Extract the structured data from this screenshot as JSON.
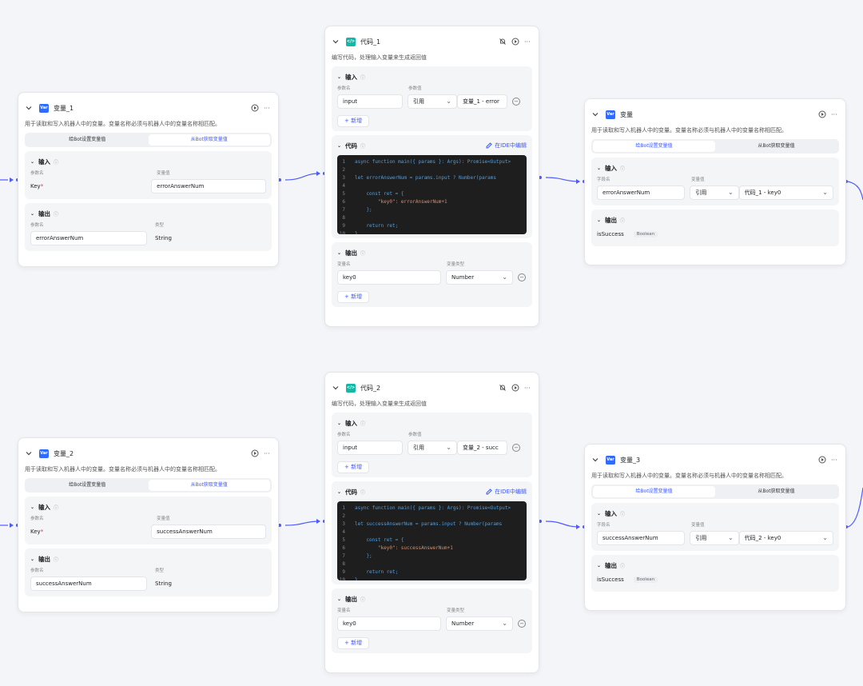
{
  "ui": {
    "expand": "⌄",
    "more": "···",
    "info": "ⓘ",
    "caret": "⌄",
    "minus": "−",
    "var_badge": "Var",
    "code_badge": "</>"
  },
  "nodes": {
    "var1": {
      "title": "变量_1",
      "desc": "用于读取和写入机器人中的变量。变量名称必须与机器人中的变量名称相匹配。",
      "seg": [
        "给Bot设置变量值",
        "从Bot获取变量值"
      ],
      "input_label": "输入",
      "col_param": "参数名",
      "col_value": "变量值",
      "key_label": "Key",
      "key_star": "*",
      "key_value": "errorAnswerNum",
      "output_label": "输出",
      "col_type": "类型",
      "out_name": "errorAnswerNum",
      "out_type": "String"
    },
    "code1": {
      "title": "代码_1",
      "desc": "编写代码，处理输入变量来生成返回值",
      "input_label": "输入",
      "col_param": "参数名",
      "col_value": "参数值",
      "in_name": "input",
      "in_mode": "引用",
      "in_ref": "变量_1 - error",
      "add_label": "+ 新增",
      "code_label": "代码",
      "ide_label": "在IDE中编辑",
      "code_lines": [
        "async function main({ params }: Args): Promise<Output>",
        "",
        "let errorAnswerNum = params.input ? Number(params",
        "",
        "    const ret = {",
        "        \"key0\": errorAnswerNum+1",
        "    };",
        "",
        "    return ret;",
        "}"
      ],
      "output_label": "输出",
      "col_var": "变量名",
      "col_vtype": "变量类型",
      "out_name": "key0",
      "out_type": "Number"
    },
    "var": {
      "title": "变量",
      "desc": "用于读取和写入机器人中的变量。变量名称必须与机器人中的变量名称相匹配。",
      "seg": [
        "给Bot设置变量值",
        "从Bot获取变量值"
      ],
      "input_label": "输入",
      "col_field": "字段名",
      "col_value": "变量值",
      "in_name": "errorAnswerNum",
      "in_mode": "引用",
      "in_ref": "代码_1 - key0",
      "output_label": "输出",
      "out_name": "isSuccess",
      "out_type": "Boolean"
    },
    "var2": {
      "title": "变量_2",
      "desc": "用于读取和写入机器人中的变量。变量名称必须与机器人中的变量名称相匹配。",
      "seg": [
        "给Bot设置变量值",
        "从Bot获取变量值"
      ],
      "input_label": "输入",
      "col_param": "参数名",
      "col_value": "变量值",
      "key_label": "Key",
      "key_star": "*",
      "key_value": "successAnswerNum",
      "output_label": "输出",
      "col_type": "类型",
      "out_name": "successAnswerNum",
      "out_type": "String"
    },
    "code2": {
      "title": "代码_2",
      "desc": "编写代码，处理输入变量来生成返回值",
      "input_label": "输入",
      "col_param": "参数名",
      "col_value": "参数值",
      "in_name": "input",
      "in_mode": "引用",
      "in_ref": "变量_2 - succ",
      "add_label": "+ 新增",
      "code_label": "代码",
      "ide_label": "在IDE中编辑",
      "code_lines": [
        "async function main({ params }: Args): Promise<Output>",
        "",
        "let successAnswerNum = params.input ? Number(params",
        "",
        "    const ret = {",
        "        \"key0\": successAnswerNum+1",
        "    };",
        "",
        "    return ret;",
        "}"
      ],
      "output_label": "输出",
      "col_var": "变量名",
      "col_vtype": "变量类型",
      "out_name": "key0",
      "out_type": "Number"
    },
    "var3": {
      "title": "变量_3",
      "desc": "用于读取和写入机器人中的变量。变量名称必须与机器人中的变量名称相匹配。",
      "seg": [
        "给Bot设置变量值",
        "从Bot获取变量值"
      ],
      "input_label": "输入",
      "col_field": "字段名",
      "col_value": "变量值",
      "in_name": "successAnswerNum",
      "in_mode": "引用",
      "in_ref": "代码_2 - key0",
      "output_label": "输出",
      "out_name": "isSuccess",
      "out_type": "Boolean"
    }
  },
  "colors": {
    "edge": "#4d5bff",
    "accent": "#3b57ff",
    "code_bg": "#1e1e1e",
    "keyword": "#569cd6",
    "string": "#ce9178",
    "func": "#dcdcaa"
  }
}
